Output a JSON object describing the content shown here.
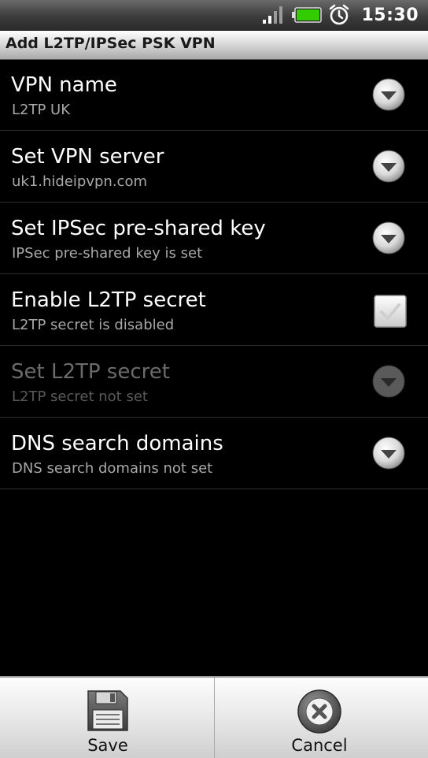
{
  "status_bar": {
    "time": "15:30",
    "icons": [
      "signal-icon",
      "battery-icon",
      "alarm-icon"
    ],
    "battery_color": "#33cc00"
  },
  "title_bar": {
    "title": "Add L2TP/IPSec PSK VPN"
  },
  "preferences": [
    {
      "title": "VPN name",
      "summary": "L2TP UK",
      "control": "dropdown",
      "enabled": true
    },
    {
      "title": "Set VPN server",
      "summary": "uk1.hideipvpn.com",
      "control": "dropdown",
      "enabled": true
    },
    {
      "title": "Set IPSec pre-shared key",
      "summary": "IPSec pre-shared key is set",
      "control": "dropdown",
      "enabled": true
    },
    {
      "title": "Enable L2TP secret",
      "summary": "L2TP secret is disabled",
      "control": "checkbox",
      "checked": false,
      "enabled": true
    },
    {
      "title": "Set L2TP secret",
      "summary": "L2TP secret not set",
      "control": "dropdown",
      "enabled": false
    },
    {
      "title": "DNS search domains",
      "summary": "DNS search domains not set",
      "control": "dropdown",
      "enabled": true
    }
  ],
  "bottom_bar": {
    "save_label": "Save",
    "cancel_label": "Cancel",
    "save_icon": "floppy-disk-icon",
    "cancel_icon": "close-circle-icon"
  }
}
